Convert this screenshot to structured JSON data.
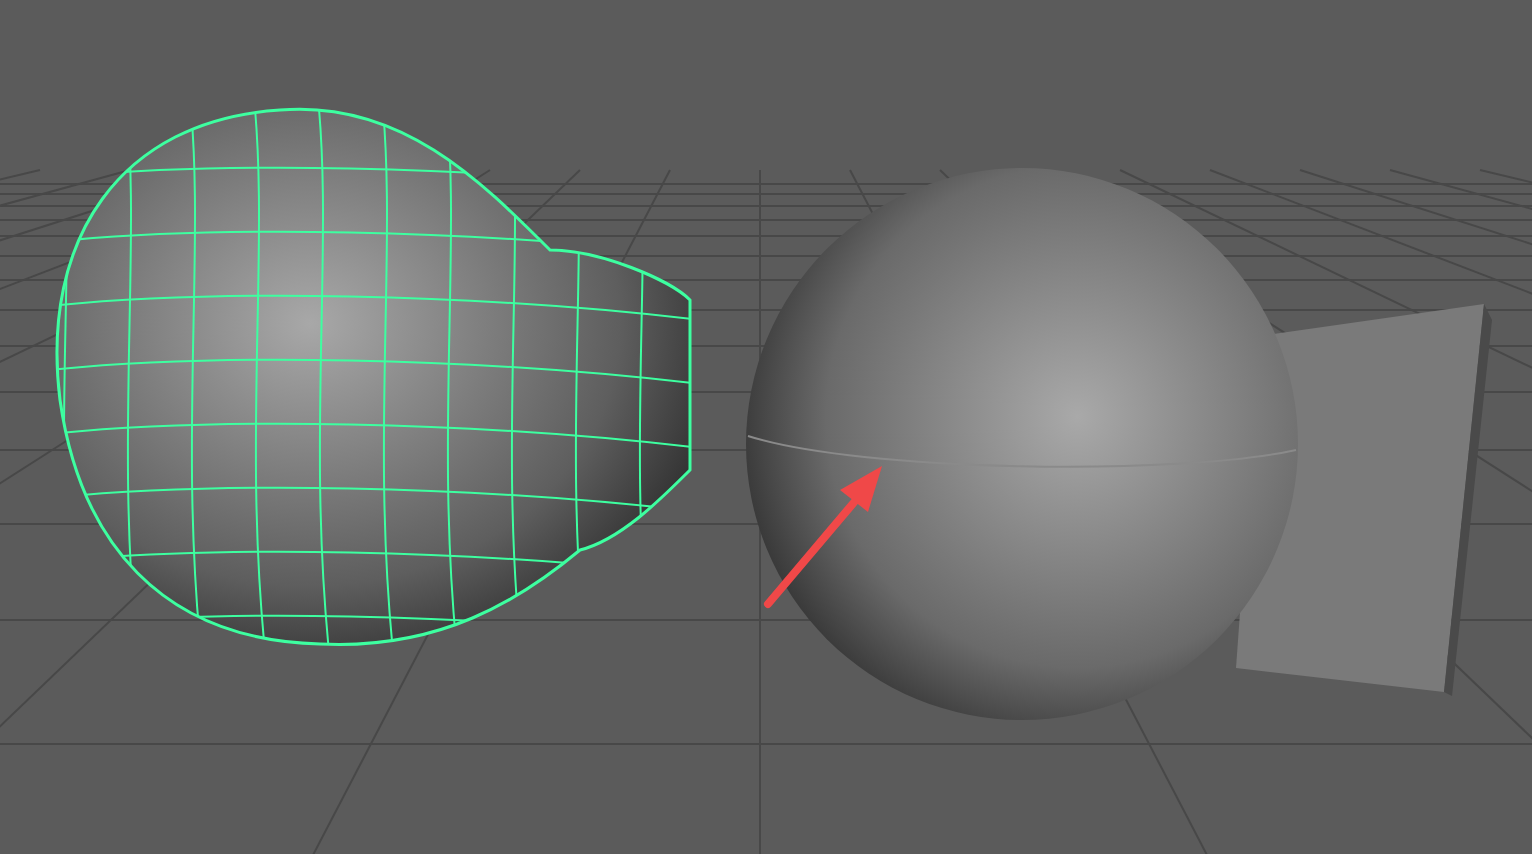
{
  "viewport": {
    "objects": [
      {
        "kind": "mesh",
        "selected": true
      },
      {
        "kind": "box",
        "selected": false
      },
      {
        "kind": "sphere",
        "selected": false
      }
    ],
    "annotation": {
      "kind": "arrow"
    }
  }
}
